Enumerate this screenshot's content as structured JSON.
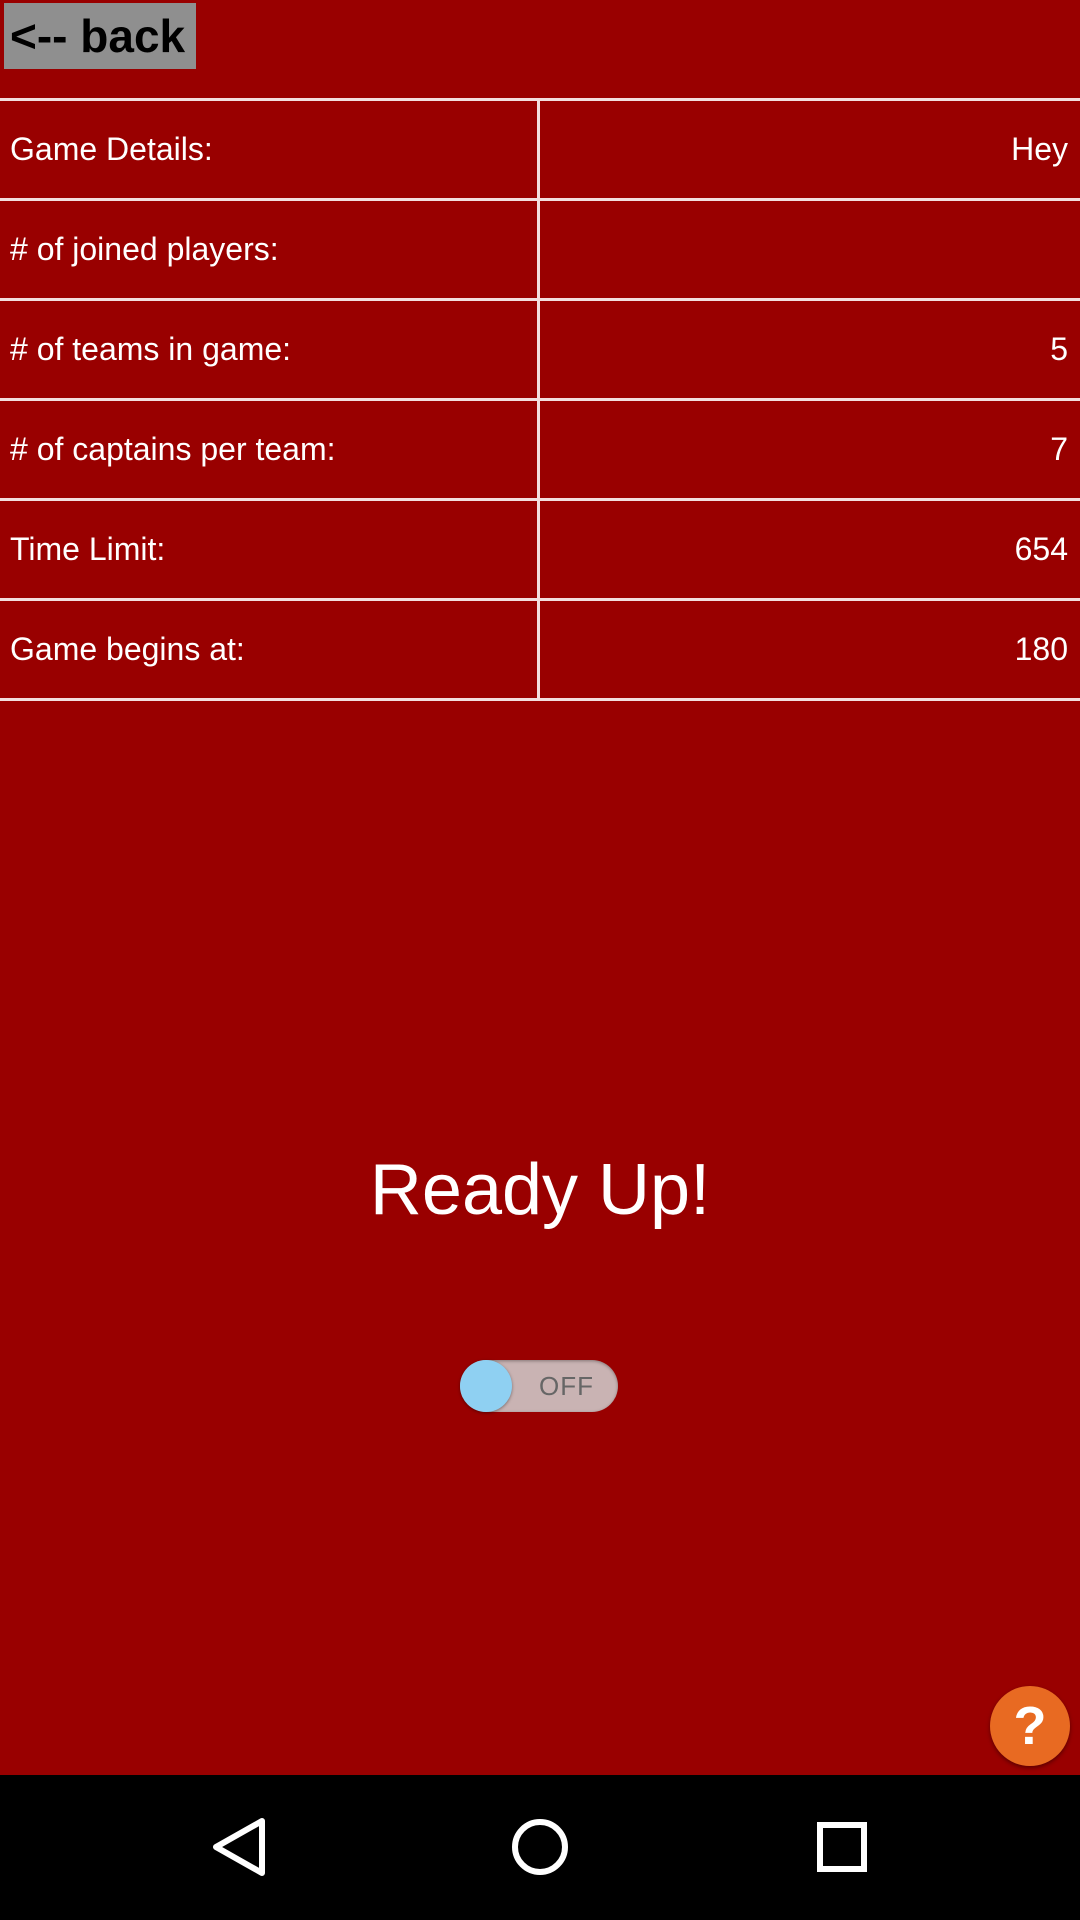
{
  "header": {
    "back_label": "<-- back"
  },
  "details": {
    "rows": [
      {
        "label": "Game Details:",
        "value": "Hey"
      },
      {
        "label": "# of joined players:",
        "value": ""
      },
      {
        "label": "# of teams in game:",
        "value": "5"
      },
      {
        "label": "# of captains per team:",
        "value": "7"
      },
      {
        "label": "Time Limit:",
        "value": "654"
      },
      {
        "label": "Game begins at:",
        "value": "180"
      }
    ]
  },
  "ready": {
    "title": "Ready Up!",
    "toggle_state_label": "OFF",
    "toggle_on": false
  },
  "help": {
    "label": "?"
  },
  "nav": {
    "icons": [
      "back-triangle-icon",
      "home-circle-icon",
      "recents-square-icon"
    ]
  },
  "colors": {
    "background": "#990000",
    "divider": "#f2dede",
    "back_button": "#8f8f8f",
    "toggle_thumb": "#8fd0f2",
    "help_button": "#e86a22",
    "nav_bar": "#000000"
  }
}
